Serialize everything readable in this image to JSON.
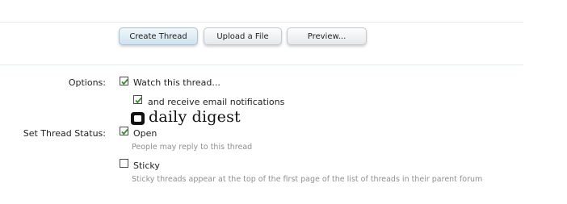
{
  "buttons": {
    "create_thread": "Create Thread",
    "upload_file": "Upload a File",
    "preview": "Preview..."
  },
  "options": {
    "label": "Options:",
    "watch_thread": {
      "label": "Watch this thread...",
      "checked": true
    },
    "email_notifications": {
      "label": "and receive email notifications",
      "checked": true
    }
  },
  "watermark": {
    "text": "daily digest"
  },
  "thread_status": {
    "label": "Set Thread Status:",
    "open": {
      "label": "Open",
      "checked": true,
      "hint": "People may reply to this thread"
    },
    "sticky": {
      "label": "Sticky",
      "checked": false,
      "hint": "Sticky threads appear at the top of the first page of the list of threads in their parent forum"
    }
  },
  "colors": {
    "checkmark": "#3a8a2e",
    "hint_text": "#8f8f8f",
    "divider": "#e3ecf1"
  }
}
